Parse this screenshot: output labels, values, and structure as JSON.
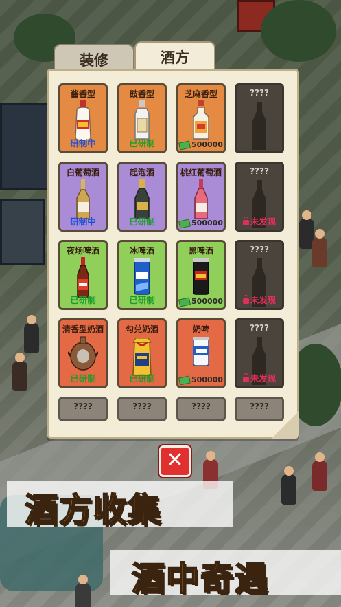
{
  "tabs": {
    "decor": "装修",
    "recipe": "酒方"
  },
  "cards": [
    {
      "title": "酱香型",
      "status": "研制中",
      "status_kind": "blue",
      "color": "orange",
      "icon": "maotai-bottle-icon"
    },
    {
      "title": "豉香型",
      "status": "已研制",
      "status_kind": "green",
      "color": "orange",
      "icon": "white-liquor-bottle-icon"
    },
    {
      "title": "芝麻香型",
      "cost": "500000",
      "color": "orange",
      "icon": "sesame-liquor-bottle-icon"
    },
    {
      "title": "????",
      "locked": true
    },
    {
      "title": "白葡萄酒",
      "status": "研制中",
      "status_kind": "blue",
      "color": "purple",
      "icon": "white-wine-bottle-icon"
    },
    {
      "title": "起泡酒",
      "status": "已研制",
      "status_kind": "green",
      "color": "purple",
      "icon": "sparkling-wine-bottle-icon"
    },
    {
      "title": "桃红葡萄酒",
      "cost": "500000",
      "color": "purple",
      "icon": "rose-wine-bottle-icon"
    },
    {
      "title": "????",
      "locked": true,
      "status": "未发现"
    },
    {
      "title": "夜场啤酒",
      "status": "已研制",
      "status_kind": "green",
      "color": "green",
      "icon": "beer-bottle-icon"
    },
    {
      "title": "冰啤酒",
      "status": "已研制",
      "status_kind": "green",
      "color": "green",
      "icon": "ice-beer-can-icon"
    },
    {
      "title": "黑啤酒",
      "cost": "500000",
      "color": "green",
      "icon": "dark-beer-can-icon"
    },
    {
      "title": "????",
      "locked": true,
      "status": "未发现"
    },
    {
      "title": "清香型奶酒",
      "status": "已研制",
      "status_kind": "green",
      "color": "red",
      "icon": "milk-liquor-vessel-icon"
    },
    {
      "title": "勾兑奶酒",
      "status": "已研制",
      "status_kind": "green",
      "color": "red",
      "icon": "blended-milk-liquor-icon"
    },
    {
      "title": "奶啤",
      "cost": "500000",
      "color": "red",
      "icon": "milk-beer-can-icon"
    },
    {
      "title": "????",
      "locked": true,
      "status": "未发现"
    },
    {
      "title": "????",
      "locked_row": true
    },
    {
      "title": "????",
      "locked_row": true
    },
    {
      "title": "????",
      "locked_row": true
    },
    {
      "title": "????",
      "locked_row": true
    }
  ],
  "close_label": "✕",
  "promo": {
    "line1": "酒方收集",
    "line2": "酒中奇遇"
  }
}
